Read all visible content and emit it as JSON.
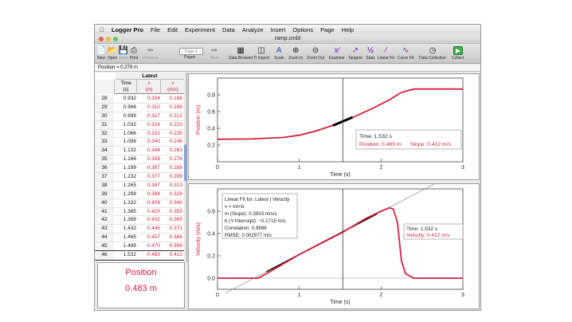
{
  "menubar": {
    "app": "Logger Pro",
    "items": [
      "File",
      "Edit",
      "Experiment",
      "Data",
      "Analyze",
      "Insert",
      "Options",
      "Page",
      "Help"
    ]
  },
  "window": {
    "title": "ramp.cmbl"
  },
  "toolbar": {
    "new": "New",
    "open": "Open",
    "save": "Save",
    "print": "Print",
    "previous": "Previous",
    "page_select": "Page 1",
    "pages": "Pages",
    "next": "Next",
    "data_browser": "Data Browser",
    "ti_import": "TI Import",
    "scale": "Scale",
    "zoom_in": "Zoom In",
    "zoom_out": "Zoom Out",
    "examine": "Examine",
    "tangent": "Tangent",
    "stats": "Stats",
    "linear_fit": "Linear Fit",
    "curve_fit": "Curve Fit",
    "data_collection": "Data Collection",
    "collect": "Collect"
  },
  "status": {
    "text": "Position = 0.279 m"
  },
  "table": {
    "dataset": "Latest",
    "columns": [
      {
        "name": "Time",
        "unit": "(s)"
      },
      {
        "name": "x",
        "unit": "(m)"
      },
      {
        "name": "v",
        "unit": "(m/s)"
      }
    ],
    "rows": [
      [
        "28",
        "0.932",
        "0.304",
        "0.186"
      ],
      [
        "29",
        "0.966",
        "0.310",
        "0.198"
      ],
      [
        "30",
        "0.999",
        "0.317",
        "0.212"
      ],
      [
        "31",
        "1.032",
        "0.324",
        "0.223"
      ],
      [
        "32",
        "1.066",
        "0.332",
        "0.235"
      ],
      [
        "33",
        "1.099",
        "0.340",
        "0.248"
      ],
      [
        "34",
        "1.132",
        "0.348",
        "0.263"
      ],
      [
        "35",
        "1.166",
        "0.358",
        "0.276"
      ],
      [
        "36",
        "1.199",
        "0.367",
        "0.288"
      ],
      [
        "37",
        "1.232",
        "0.377",
        "0.299"
      ],
      [
        "38",
        "1.265",
        "0.387",
        "0.313"
      ],
      [
        "39",
        "1.299",
        "0.398",
        "0.328"
      ],
      [
        "40",
        "1.332",
        "0.409",
        "0.340"
      ],
      [
        "41",
        "1.365",
        "0.420",
        "0.355"
      ],
      [
        "42",
        "1.399",
        "0.432",
        "0.365"
      ],
      [
        "43",
        "1.432",
        "0.445",
        "0.371"
      ],
      [
        "44",
        "1.465",
        "0.457",
        "0.386"
      ],
      [
        "45",
        "1.499",
        "0.470",
        "0.399"
      ],
      [
        "46",
        "1.532",
        "0.483",
        "0.412"
      ]
    ]
  },
  "meter": {
    "label": "Position",
    "value": "0.483 m"
  },
  "colors": {
    "series": "#d1213f",
    "fit": "#111111",
    "cursor": "#333333"
  },
  "chart_data": [
    {
      "type": "line",
      "xlabel": "Time (s)",
      "ylabel": "Position (m)",
      "xlim": [
        0,
        3
      ],
      "ylim": [
        0,
        1.0
      ],
      "xticks": [
        "0",
        "1",
        "2",
        "3"
      ],
      "yticks": [
        "0.2",
        "0.4",
        "0.6",
        "0.8"
      ],
      "series": [
        {
          "x": [
            0,
            0.4,
            0.8,
            1.0,
            1.2,
            1.4,
            1.532,
            1.7,
            1.9,
            2.1,
            2.25,
            2.4,
            3.0
          ],
          "y": [
            0.27,
            0.272,
            0.29,
            0.317,
            0.367,
            0.432,
            0.483,
            0.55,
            0.64,
            0.74,
            0.83,
            0.87,
            0.87
          ]
        }
      ],
      "annotation": {
        "time": "Time: 1.532 s",
        "position": "Position: 0.483 m",
        "slope": "Slope: 0.412 m/s"
      }
    },
    {
      "type": "line",
      "xlabel": "Time (s)",
      "ylabel": "Velocity (m/s)",
      "xlim": [
        0,
        3
      ],
      "ylim": [
        -0.1,
        0.8
      ],
      "xticks": [
        "0",
        "1",
        "2",
        "3"
      ],
      "yticks": [
        "0.0",
        "0.2",
        "0.4",
        "0.6"
      ],
      "series": [
        {
          "x": [
            0,
            0.1,
            0.5,
            0.6,
            1.0,
            1.532,
            1.8,
            2.0,
            2.1,
            2.15,
            2.2,
            2.25,
            2.3,
            2.4,
            2.6,
            3.0
          ],
          "y": [
            0.0,
            0.0,
            0.0,
            0.04,
            0.212,
            0.412,
            0.53,
            0.6,
            0.63,
            0.62,
            0.5,
            0.15,
            0.04,
            0.0,
            0.0,
            0.0
          ]
        }
      ],
      "fit": {
        "title": "Linear Fit for: Latest | Velocity",
        "equation": "v = mt+b",
        "slope": "m (Slope): 0.3833 m/s/s",
        "intercept": "b (Y-Intercept): −0.1715 m/s",
        "correlation": "Correlation: 0.9998",
        "rmse": "RMSE: 0.002977 m/s",
        "m": 0.3833,
        "b": -0.1715
      },
      "annotation": {
        "time": "Time: 1.532 s",
        "velocity": "Velocity: 0.412 m/s"
      }
    }
  ]
}
